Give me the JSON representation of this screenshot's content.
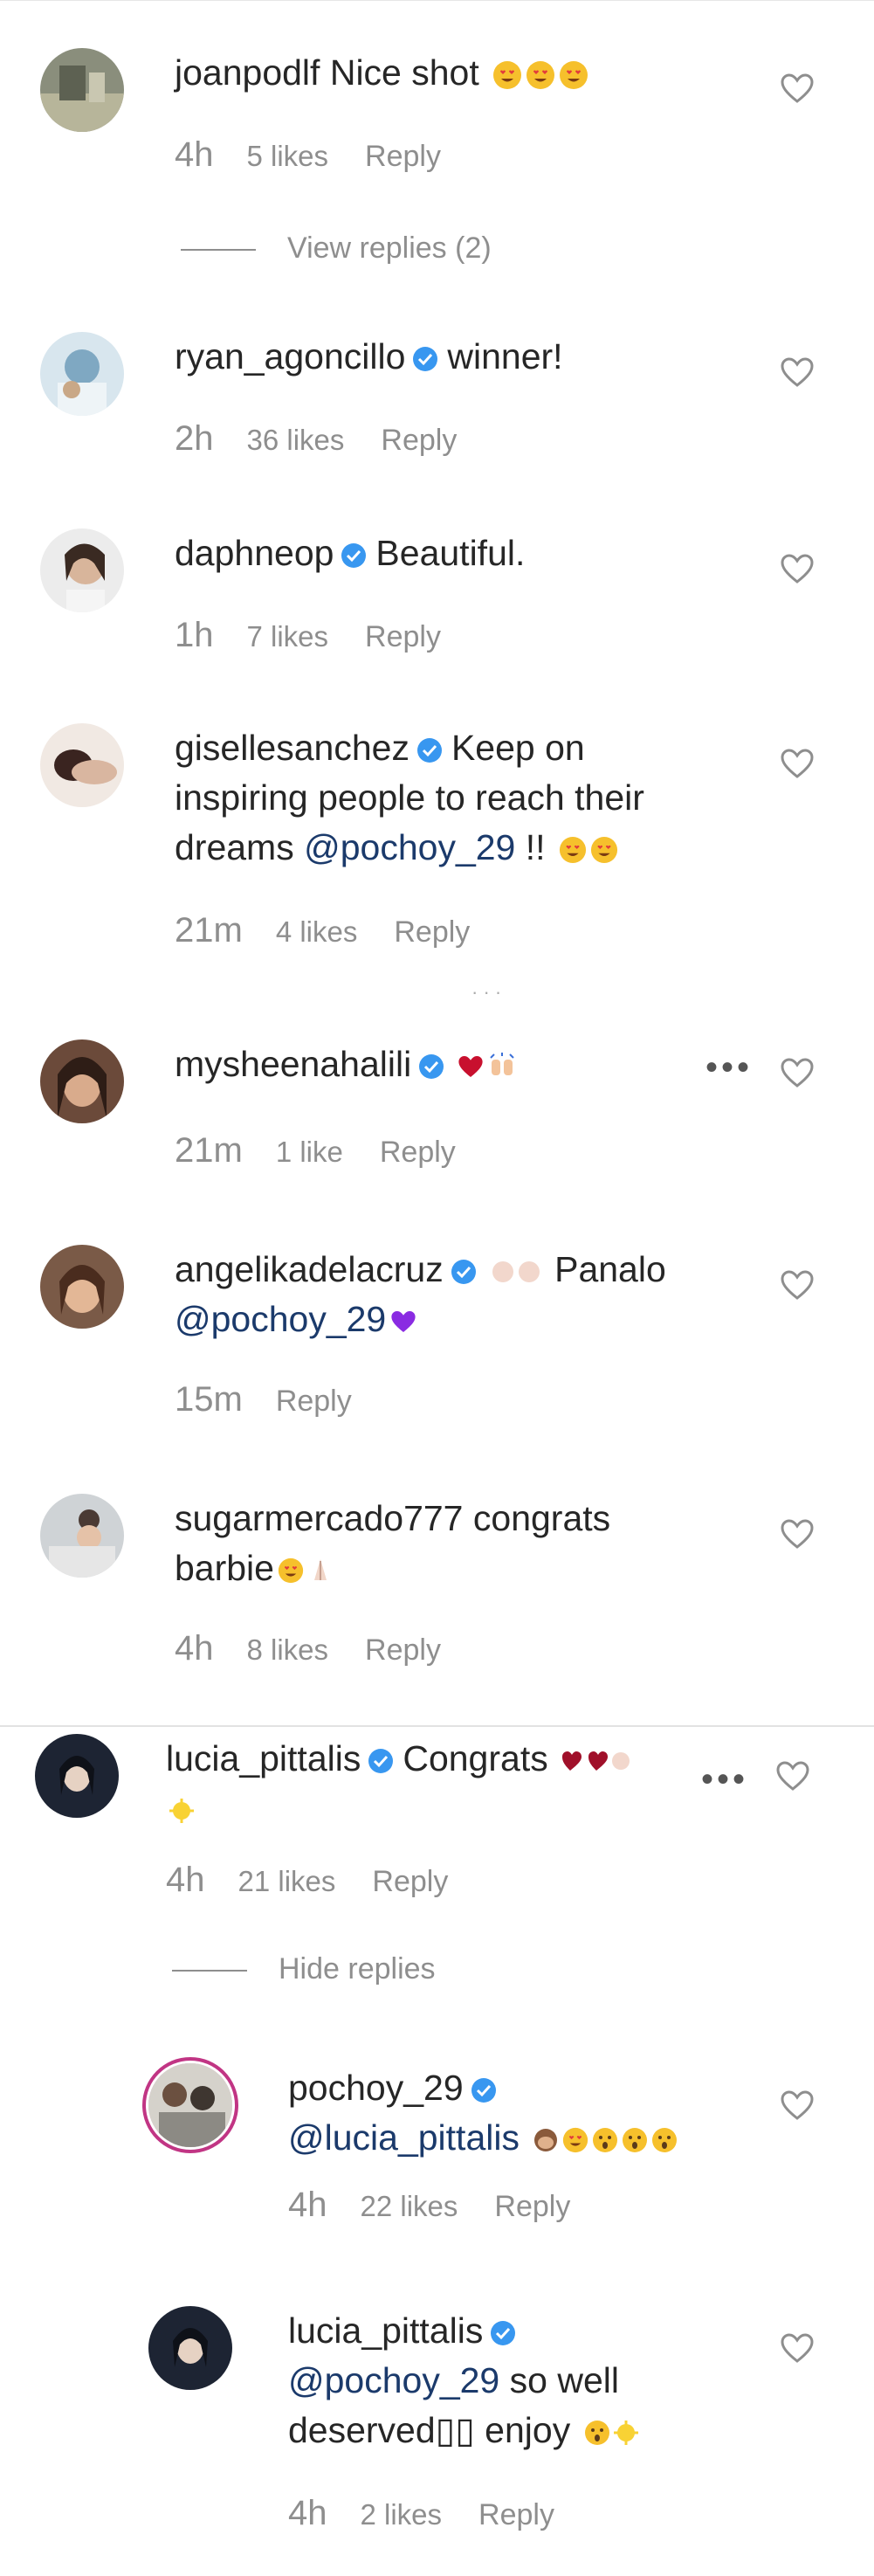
{
  "comments": [
    {
      "username": "joanpodlf",
      "verified": false,
      "text": "Nice shot",
      "emojis": [
        "heart-eyes",
        "heart-eyes",
        "heart-eyes"
      ],
      "time": "4h",
      "likes": "5 likes",
      "reply_label": "Reply",
      "thread_toggle": "View replies (2)"
    },
    {
      "username": "ryan_agoncillo",
      "verified": true,
      "text": "winner!",
      "time": "2h",
      "likes": "36 likes",
      "reply_label": "Reply"
    },
    {
      "username": "daphneop",
      "verified": true,
      "text": "Beautiful.",
      "time": "1h",
      "likes": "7 likes",
      "reply_label": "Reply"
    },
    {
      "username": "gisellesanchez",
      "verified": true,
      "text_line1": "Keep on",
      "text_line2": "inspiring people to reach their",
      "text_line3_pre": "dreams ",
      "mention": "@pochoy_29",
      "text_line3_post": " !! ",
      "emojis": [
        "heart-eyes",
        "heart-eyes"
      ],
      "time": "21m",
      "likes": "4 likes",
      "reply_label": "Reply"
    },
    {
      "username": "mysheenahalili",
      "verified": true,
      "emojis": [
        "red-heart",
        "raising-hands"
      ],
      "time": "21m",
      "likes": "1 like",
      "reply_label": "Reply"
    },
    {
      "username": "angelikadelacruz",
      "verified": true,
      "text_line1": "Panalo",
      "mention": "@pochoy_29",
      "emojis": [
        "praying-hands",
        "purple-heart"
      ],
      "time": "15m",
      "reply_label": "Reply"
    },
    {
      "username": "sugarmercado777",
      "verified": false,
      "text_line1": "congrats",
      "text_line2": "barbie",
      "emojis": [
        "heart-eyes",
        "prayer"
      ],
      "time": "4h",
      "likes": "8 likes",
      "reply_label": "Reply"
    },
    {
      "username": "lucia_pittalis",
      "verified": true,
      "text": "Congrats",
      "emojis": [
        "hearts",
        "praying",
        "sparkle"
      ],
      "time": "4h",
      "likes": "21 likes",
      "reply_label": "Reply",
      "thread_toggle": "Hide replies"
    }
  ],
  "replies": [
    {
      "username": "pochoy_29",
      "verified": true,
      "mention": "@lucia_pittalis",
      "emojis": [
        "see-no-evil",
        "heart-eyes",
        "astonished",
        "astonished",
        "astonished"
      ],
      "time": "4h",
      "likes": "22 likes",
      "reply_label": "Reply"
    },
    {
      "username": "lucia_pittalis",
      "verified": true,
      "mention": "@pochoy_29",
      "text_line1_post": " so well",
      "text_line2": "deserved▯▯ enjoy ",
      "emojis": [
        "astonished",
        "sparkle"
      ],
      "time": "4h",
      "likes": "2 likes",
      "reply_label": "Reply"
    }
  ],
  "colors": {
    "verified": "#3897f0",
    "muted": "#8e8e8e",
    "text": "#262626",
    "mention": "#1b3a6b",
    "emoji": "#f6c02c"
  }
}
